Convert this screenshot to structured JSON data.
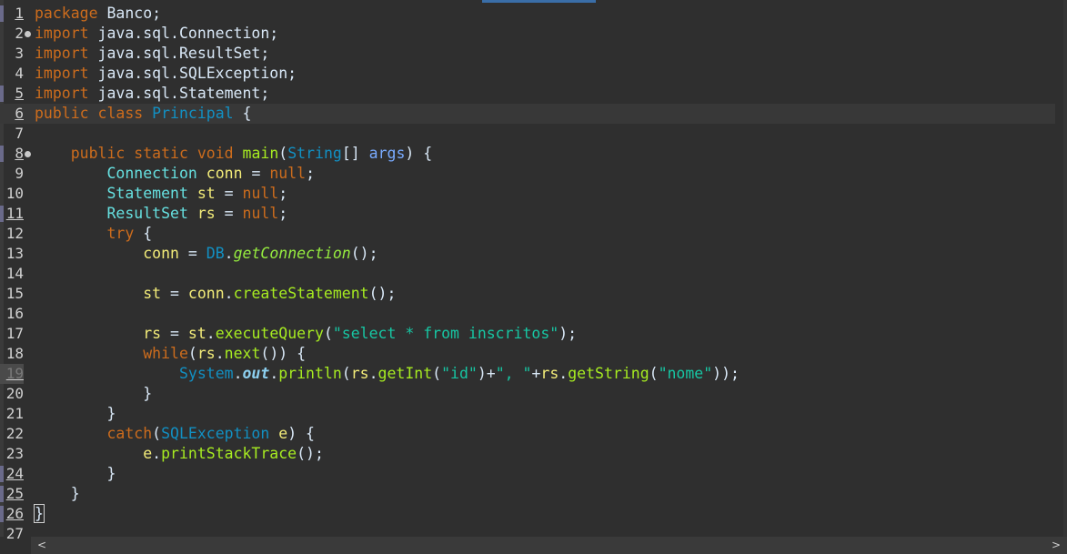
{
  "editor": {
    "language": "java",
    "lines": [
      {
        "n": "1",
        "segs": [
          [
            "kw",
            "package"
          ],
          [
            "p",
            " Banco;"
          ]
        ]
      },
      {
        "n": "2",
        "fold": true,
        "segs": [
          [
            "kw",
            "import"
          ],
          [
            "p",
            " java.sql.Connection;"
          ]
        ]
      },
      {
        "n": "3",
        "segs": [
          [
            "kw",
            "import"
          ],
          [
            "p",
            " java.sql.ResultSet;"
          ]
        ]
      },
      {
        "n": "4",
        "segs": [
          [
            "kw",
            "import"
          ],
          [
            "p",
            " java.sql.SQLException;"
          ]
        ]
      },
      {
        "n": "5",
        "segs": [
          [
            "kw",
            "import"
          ],
          [
            "p",
            " java.sql.Statement;"
          ]
        ]
      },
      {
        "n": "6",
        "current": true,
        "segs": [
          [
            "kw",
            "public"
          ],
          [
            "p",
            " "
          ],
          [
            "kw",
            "class"
          ],
          [
            "p",
            " "
          ],
          [
            "cls",
            "Principal"
          ],
          [
            "p",
            " {"
          ]
        ]
      },
      {
        "n": "7",
        "segs": []
      },
      {
        "n": "8",
        "fold": true,
        "segs": [
          [
            "p",
            "    "
          ],
          [
            "kw",
            "public"
          ],
          [
            "p",
            " "
          ],
          [
            "kw",
            "static"
          ],
          [
            "p",
            " "
          ],
          [
            "kw",
            "void"
          ],
          [
            "p",
            " "
          ],
          [
            "fn",
            "main"
          ],
          [
            "p",
            "("
          ],
          [
            "cls",
            "String"
          ],
          [
            "p",
            "[] "
          ],
          [
            "prm",
            "args"
          ],
          [
            "p",
            ") {"
          ]
        ]
      },
      {
        "n": "9",
        "segs": [
          [
            "p",
            "        "
          ],
          [
            "ty",
            "Connection"
          ],
          [
            "p",
            " "
          ],
          [
            "var",
            "conn"
          ],
          [
            "p",
            " = "
          ],
          [
            "kw",
            "null"
          ],
          [
            "p",
            ";"
          ]
        ]
      },
      {
        "n": "10",
        "segs": [
          [
            "p",
            "        "
          ],
          [
            "ty",
            "Statement"
          ],
          [
            "p",
            " "
          ],
          [
            "var",
            "st"
          ],
          [
            "p",
            " = "
          ],
          [
            "kw",
            "null"
          ],
          [
            "p",
            ";"
          ]
        ]
      },
      {
        "n": "11",
        "segs": [
          [
            "p",
            "        "
          ],
          [
            "ty",
            "ResultSet"
          ],
          [
            "p",
            " "
          ],
          [
            "var",
            "rs"
          ],
          [
            "p",
            " = "
          ],
          [
            "kw",
            "null"
          ],
          [
            "p",
            ";"
          ]
        ]
      },
      {
        "n": "12",
        "segs": [
          [
            "p",
            "        "
          ],
          [
            "kw",
            "try"
          ],
          [
            "p",
            " {"
          ]
        ]
      },
      {
        "n": "13",
        "segs": [
          [
            "p",
            "            "
          ],
          [
            "var",
            "conn"
          ],
          [
            "p",
            " = "
          ],
          [
            "cls",
            "DB"
          ],
          [
            "p",
            "."
          ],
          [
            "stat",
            "getConnection"
          ],
          [
            "p",
            "();"
          ]
        ]
      },
      {
        "n": "14",
        "segs": []
      },
      {
        "n": "15",
        "segs": [
          [
            "p",
            "            "
          ],
          [
            "var",
            "st"
          ],
          [
            "p",
            " = "
          ],
          [
            "var",
            "conn"
          ],
          [
            "p",
            "."
          ],
          [
            "fn",
            "createStatement"
          ],
          [
            "p",
            "();"
          ]
        ]
      },
      {
        "n": "16",
        "segs": []
      },
      {
        "n": "17",
        "segs": [
          [
            "p",
            "            "
          ],
          [
            "var",
            "rs"
          ],
          [
            "p",
            " = "
          ],
          [
            "var",
            "st"
          ],
          [
            "p",
            "."
          ],
          [
            "fn",
            "executeQuery"
          ],
          [
            "p",
            "("
          ],
          [
            "st",
            "\"select * from inscritos\""
          ],
          [
            "p",
            ");"
          ]
        ]
      },
      {
        "n": "18",
        "segs": [
          [
            "p",
            "            "
          ],
          [
            "kw",
            "while"
          ],
          [
            "p",
            "("
          ],
          [
            "var",
            "rs"
          ],
          [
            "p",
            "."
          ],
          [
            "fn",
            "next"
          ],
          [
            "p",
            "()) {"
          ]
        ]
      },
      {
        "n": "19",
        "dim": true,
        "segs": [
          [
            "p",
            "                "
          ],
          [
            "cls",
            "System"
          ],
          [
            "p",
            "."
          ],
          [
            "sf",
            "out"
          ],
          [
            "p",
            "."
          ],
          [
            "fn",
            "println"
          ],
          [
            "p",
            "("
          ],
          [
            "var",
            "rs"
          ],
          [
            "p",
            "."
          ],
          [
            "fn",
            "getInt"
          ],
          [
            "p",
            "("
          ],
          [
            "st",
            "\"id\""
          ],
          [
            "p",
            ")+"
          ],
          [
            "st",
            "\", \""
          ],
          [
            "p",
            "+"
          ],
          [
            "var",
            "rs"
          ],
          [
            "p",
            "."
          ],
          [
            "fn",
            "getString"
          ],
          [
            "p",
            "("
          ],
          [
            "st",
            "\"nome\""
          ],
          [
            "p",
            "));"
          ]
        ]
      },
      {
        "n": "20",
        "segs": [
          [
            "p",
            "            }"
          ]
        ]
      },
      {
        "n": "21",
        "segs": [
          [
            "p",
            "        }"
          ]
        ]
      },
      {
        "n": "22",
        "segs": [
          [
            "p",
            "        "
          ],
          [
            "kw",
            "catch"
          ],
          [
            "p",
            "("
          ],
          [
            "cls",
            "SQLException"
          ],
          [
            "p",
            " "
          ],
          [
            "var",
            "e"
          ],
          [
            "p",
            ") {"
          ]
        ]
      },
      {
        "n": "23",
        "segs": [
          [
            "p",
            "            "
          ],
          [
            "var",
            "e"
          ],
          [
            "p",
            "."
          ],
          [
            "fn",
            "printStackTrace"
          ],
          [
            "p",
            "();"
          ]
        ]
      },
      {
        "n": "24",
        "segs": [
          [
            "p",
            "        }"
          ]
        ]
      },
      {
        "n": "25",
        "segs": [
          [
            "p",
            "    }"
          ]
        ]
      },
      {
        "n": "26",
        "segs": [
          [
            "box",
            "}"
          ]
        ]
      },
      {
        "n": "27",
        "segs": []
      }
    ]
  },
  "scrollbar": {
    "left_arrow": "<",
    "right_arrow": ">"
  }
}
